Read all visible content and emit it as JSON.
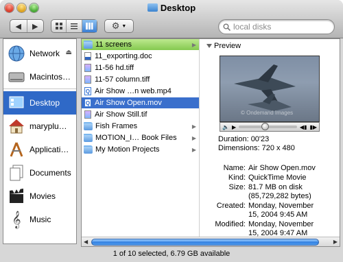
{
  "window": {
    "title": "Desktop"
  },
  "toolbar": {
    "back_icon": "back-arrow-icon",
    "forward_icon": "forward-arrow-icon",
    "search_placeholder": "local disks"
  },
  "sidebar": {
    "items": [
      {
        "label": "Network",
        "icon": "network-globe-icon"
      },
      {
        "label": "Macintos…",
        "icon": "hard-drive-icon"
      },
      {
        "label": "Desktop",
        "icon": "desktop-icon"
      },
      {
        "label": "maryplu…",
        "icon": "home-icon"
      },
      {
        "label": "Applicati…",
        "icon": "applications-icon"
      },
      {
        "label": "Documents",
        "icon": "documents-icon"
      },
      {
        "label": "Movies",
        "icon": "movies-clapper-icon"
      },
      {
        "label": "Music",
        "icon": "music-clef-icon"
      }
    ]
  },
  "files": [
    {
      "label": "11 screens",
      "type": "folder"
    },
    {
      "label": "11_exporting.doc",
      "type": "word"
    },
    {
      "label": "11-56 hd.tiff",
      "type": "tiff"
    },
    {
      "label": "11-57 column.tiff",
      "type": "tiff"
    },
    {
      "label": "Air Show …n web.mp4",
      "type": "mov"
    },
    {
      "label": "Air Show Open.mov",
      "type": "mov"
    },
    {
      "label": "Air Show Still.tif",
      "type": "tiff"
    },
    {
      "label": "Fish Frames",
      "type": "folder"
    },
    {
      "label": "MOTION_I… Book Files",
      "type": "folder"
    },
    {
      "label": "My Motion Projects",
      "type": "folder"
    }
  ],
  "preview": {
    "heading": "Preview",
    "watermark": "© Ondemand Images",
    "duration": "Duration: 00'23",
    "dimensions": "Dimensions: 720 x 480",
    "name_label": "Name:",
    "name_value": "Air Show Open.mov",
    "kind_label": "Kind:",
    "kind_value": "QuickTime Movie",
    "size_label": "Size:",
    "size_value": "81.7 MB on disk",
    "size_value2": "(85,729,282 bytes)",
    "created_label": "Created:",
    "created_value": "Monday, November",
    "created_value2": "15, 2004 9:45 AM",
    "modified_label": "Modified:",
    "modified_value": "Monday, November",
    "modified_value2": "15, 2004 9:47 AM",
    "playhead_fraction": 0.45
  },
  "status": "1 of 10 selected, 6.79 GB available",
  "colors": {
    "selection": "#3a6fcc",
    "folder_highlight": "#84c94f"
  }
}
